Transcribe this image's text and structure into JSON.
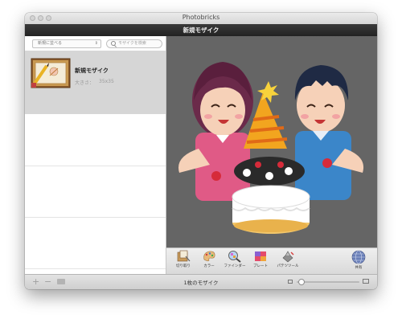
{
  "window": {
    "title": "Photobricks"
  },
  "document": {
    "title": "新規モザイク"
  },
  "sidebar": {
    "sort_label": "新規に並べる",
    "search_placeholder": "モザイクを検索",
    "items": [
      {
        "name": "新規モザイク",
        "size_label": "大きさ：",
        "size_value": "35x35"
      }
    ]
  },
  "toolbar": {
    "items": [
      {
        "label": "切り取り",
        "icon": "crop-icon"
      },
      {
        "label": "カラー",
        "icon": "color-palette-icon"
      },
      {
        "label": "ファインダー",
        "icon": "finder-icon"
      },
      {
        "label": "プレート",
        "icon": "plate-icon"
      },
      {
        "label": "パテツツール",
        "icon": "patch-tool-icon"
      },
      {
        "label": "共有",
        "icon": "share-globe-icon"
      }
    ]
  },
  "statusbar": {
    "text": "1枚のモザイク",
    "zoom_level": 0.03
  },
  "colors": {
    "canvas_bg": "#656565",
    "selection": "#d6d6d6"
  }
}
